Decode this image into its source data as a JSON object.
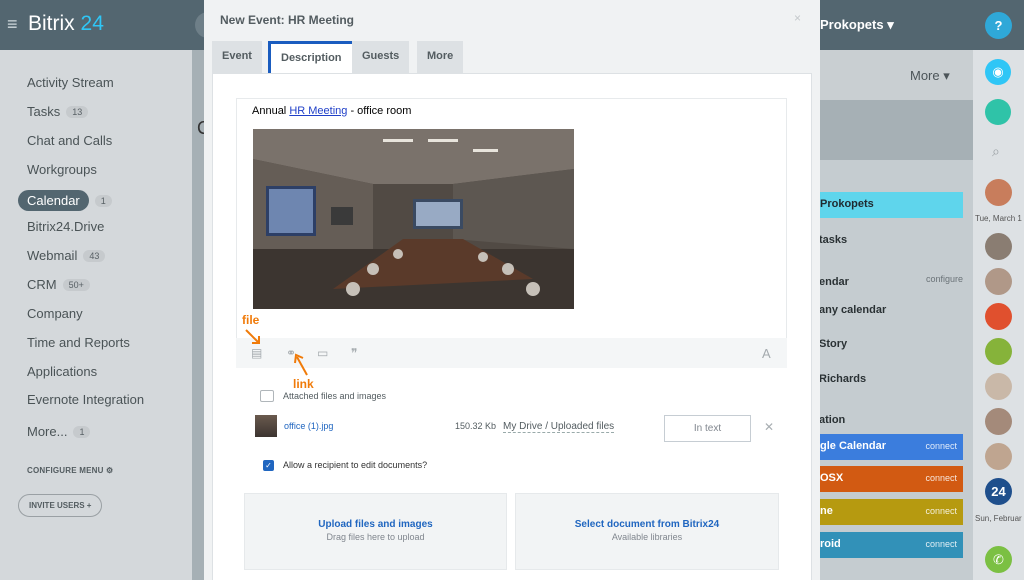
{
  "app": {
    "title_a": "Bitrix",
    "title_b": "24",
    "user": "Prokopets"
  },
  "nav": {
    "items": [
      {
        "label": "Activity Stream",
        "count": ""
      },
      {
        "label": "Tasks",
        "count": "13"
      },
      {
        "label": "Chat and Calls",
        "count": ""
      },
      {
        "label": "Workgroups",
        "count": ""
      },
      {
        "label": "Calendar",
        "count": "1"
      },
      {
        "label": "Bitrix24.Drive",
        "count": ""
      },
      {
        "label": "Webmail",
        "count": "43"
      },
      {
        "label": "CRM",
        "count": "50+"
      },
      {
        "label": "Company",
        "count": ""
      },
      {
        "label": "Time and Reports",
        "count": ""
      },
      {
        "label": "Applications",
        "count": ""
      },
      {
        "label": "Evernote Integration",
        "count": ""
      },
      {
        "label": "More...",
        "count": "1"
      }
    ],
    "configure_menu": "CONFIGURE MENU",
    "invite_users": "INVITE USERS"
  },
  "background": {
    "more": "More",
    "c_letter": "C",
    "right_panel": {
      "user": "Prokopets",
      "rows": [
        "tasks",
        "endar",
        "any calendar",
        "Story",
        "Richards",
        "ation"
      ],
      "configure": "configure",
      "bars": [
        {
          "label": "gle Calendar",
          "connect": "connect",
          "color": "#3b7ddd"
        },
        {
          "label": "OSX",
          "connect": "connect",
          "color": "#d25a12"
        },
        {
          "label": "ne",
          "connect": "connect",
          "color": "#b69a10"
        },
        {
          "label": "roid",
          "connect": "connect",
          "color": "#3291b8"
        }
      ]
    }
  },
  "rightbar": {
    "help": "?",
    "date1": "Tue, March 1",
    "date2": "Sun, Februar",
    "badge": "24"
  },
  "modal": {
    "title": "New Event: HR Meeting",
    "close": "×",
    "tabs": [
      "Event",
      "Description",
      "Guests",
      "More"
    ],
    "editor": {
      "text_before": "Annual ",
      "link": "HR Meeting",
      "text_after": " - office room"
    },
    "annotations": {
      "file": "file",
      "link": "link"
    },
    "toolbar_right": "A",
    "attached_header": "Attached files and images",
    "file": {
      "name": "office (1).jpg",
      "size": "150.32 Kb",
      "path": "My Drive / Uploaded files",
      "button": "In text",
      "remove": "✕"
    },
    "checkbox_label": "Allow a recipient to edit documents?",
    "upload": {
      "title": "Upload files and images",
      "subtitle": "Drag files here to upload"
    },
    "select_doc": {
      "title": "Select document from Bitrix24",
      "subtitle": "Available libraries"
    }
  }
}
